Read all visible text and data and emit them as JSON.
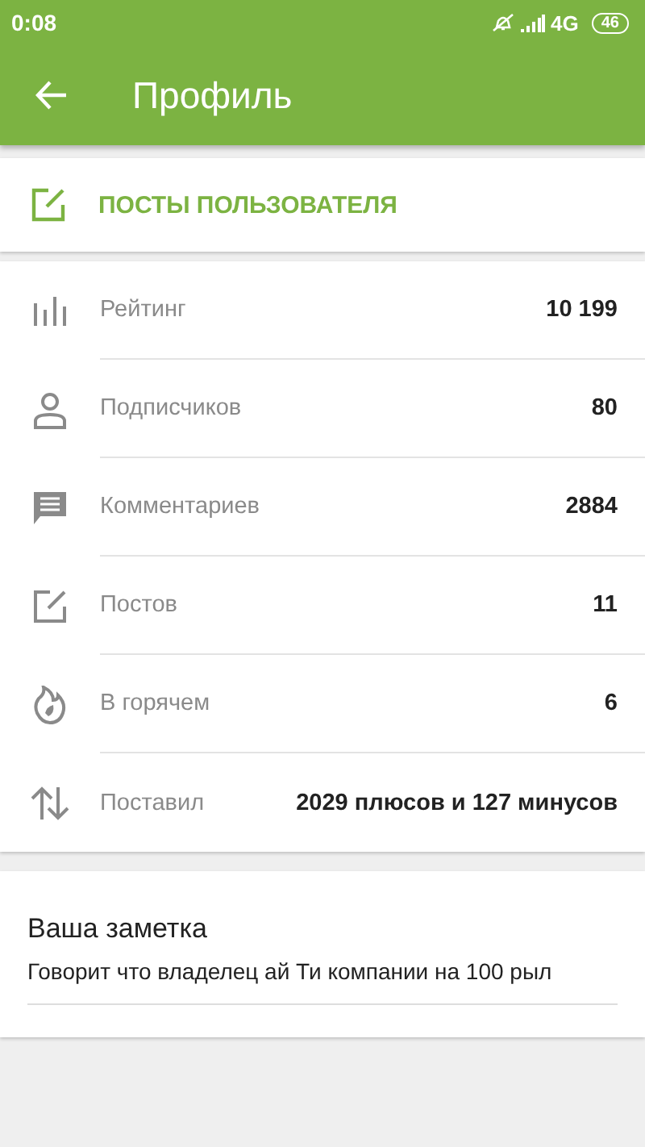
{
  "status_bar": {
    "time": "0:08",
    "network": "4G",
    "battery": "46"
  },
  "app_bar": {
    "title": "Профиль"
  },
  "posts_link": {
    "label": "ПОСТЫ ПОЛЬЗОВАТЕЛЯ"
  },
  "stats": [
    {
      "kind": "rating",
      "label": "Рейтинг",
      "value": "10 199"
    },
    {
      "kind": "subscribers",
      "label": "Подписчиков",
      "value": "80"
    },
    {
      "kind": "comments",
      "label": "Комментариев",
      "value": "2884"
    },
    {
      "kind": "posts",
      "label": "Постов",
      "value": "11"
    },
    {
      "kind": "hot",
      "label": "В горячем",
      "value": "6"
    },
    {
      "kind": "votes",
      "label": "Поставил",
      "value": "2029 плюсов и 127 минусов"
    }
  ],
  "note": {
    "title": "Ваша заметка",
    "value": "Говорит что владелец ай Ти компании на 100 рыл"
  }
}
